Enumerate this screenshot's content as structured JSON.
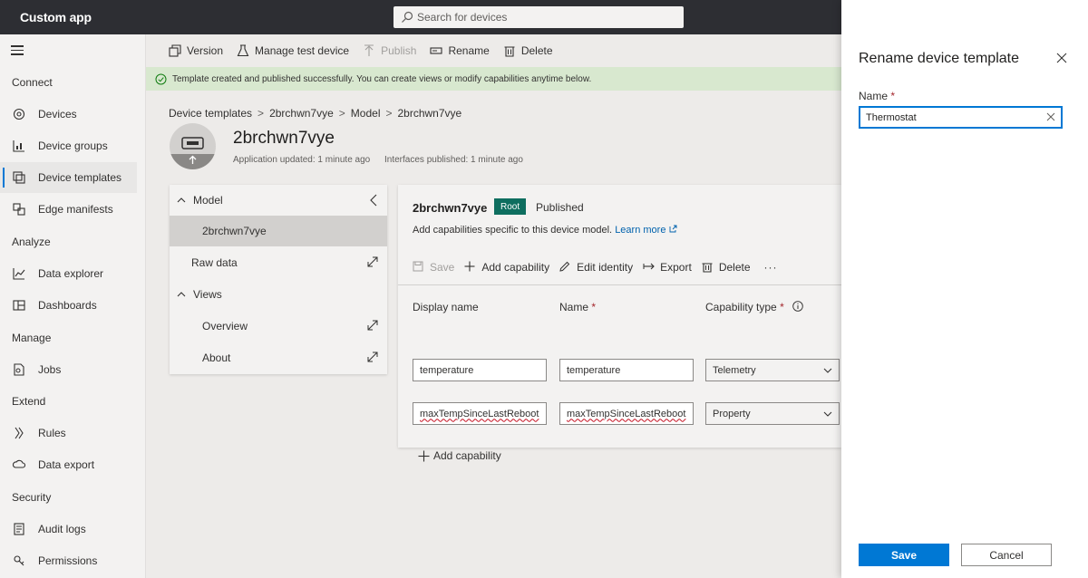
{
  "app": {
    "title": "Custom app"
  },
  "search": {
    "placeholder": "Search for devices"
  },
  "topbar": {
    "icons": [
      "settings-icon",
      "help-icon",
      "account-icon"
    ]
  },
  "sidebar": {
    "sections": [
      {
        "title": "Connect",
        "items": [
          {
            "label": "Devices",
            "icon": "devices-icon"
          },
          {
            "label": "Device groups",
            "icon": "device-groups-icon"
          },
          {
            "label": "Device templates",
            "icon": "device-templates-icon",
            "active": true
          },
          {
            "label": "Edge manifests",
            "icon": "edge-manifests-icon"
          }
        ]
      },
      {
        "title": "Analyze",
        "items": [
          {
            "label": "Data explorer",
            "icon": "data-explorer-icon"
          },
          {
            "label": "Dashboards",
            "icon": "dashboards-icon"
          }
        ]
      },
      {
        "title": "Manage",
        "items": [
          {
            "label": "Jobs",
            "icon": "jobs-icon"
          }
        ]
      },
      {
        "title": "Extend",
        "items": [
          {
            "label": "Rules",
            "icon": "rules-icon"
          },
          {
            "label": "Data export",
            "icon": "data-export-icon"
          }
        ]
      },
      {
        "title": "Security",
        "items": [
          {
            "label": "Audit logs",
            "icon": "audit-logs-icon"
          },
          {
            "label": "Permissions",
            "icon": "permissions-icon"
          }
        ]
      }
    ]
  },
  "toolbar": {
    "version": "Version",
    "manage_test_device": "Manage test device",
    "publish": "Publish",
    "rename": "Rename",
    "delete": "Delete"
  },
  "banner": {
    "text": "Template created and published successfully. You can create views or modify capabilities anytime below."
  },
  "breadcrumb": [
    "Device templates",
    "2brchwn7vye",
    "Model",
    "2brchwn7vye"
  ],
  "template": {
    "name": "2brchwn7vye",
    "app_updated": "Application updated: 1 minute ago",
    "interfaces_published": "Interfaces published: 1 minute ago"
  },
  "tree": {
    "model": "Model",
    "model_child": "2brchwn7vye",
    "raw_data": "Raw data",
    "views": "Views",
    "overview": "Overview",
    "about": "About"
  },
  "capability_panel": {
    "title": "2brchwn7vye",
    "root_badge": "Root",
    "status": "Published",
    "description": "Add capabilities specific to this device model.",
    "learn_more": "Learn more",
    "toolbar": {
      "save": "Save",
      "add_capability": "Add capability",
      "edit_identity": "Edit identity",
      "export": "Export",
      "delete": "Delete",
      "more": "···"
    },
    "columns": {
      "display_name": "Display name",
      "name": "Name",
      "name_required": "*",
      "capability_type": "Capability type",
      "type_required": "*"
    },
    "rows": [
      {
        "display_name": "temperature",
        "name": "temperature",
        "type": "Telemetry"
      },
      {
        "display_name": "maxTempSinceLastReboot",
        "name": "maxTempSinceLastReboot",
        "type": "Property"
      }
    ],
    "add_capability": "Add capability"
  },
  "dialog": {
    "title": "Rename device template",
    "name_label": "Name",
    "required_mark": "*",
    "name_value": "Thermostat",
    "save": "Save",
    "cancel": "Cancel"
  },
  "colors": {
    "accent": "#0078d4",
    "topbar": "#2d2e33",
    "root_badge": "#0e6e5f",
    "banner": "#d8e8cf"
  }
}
